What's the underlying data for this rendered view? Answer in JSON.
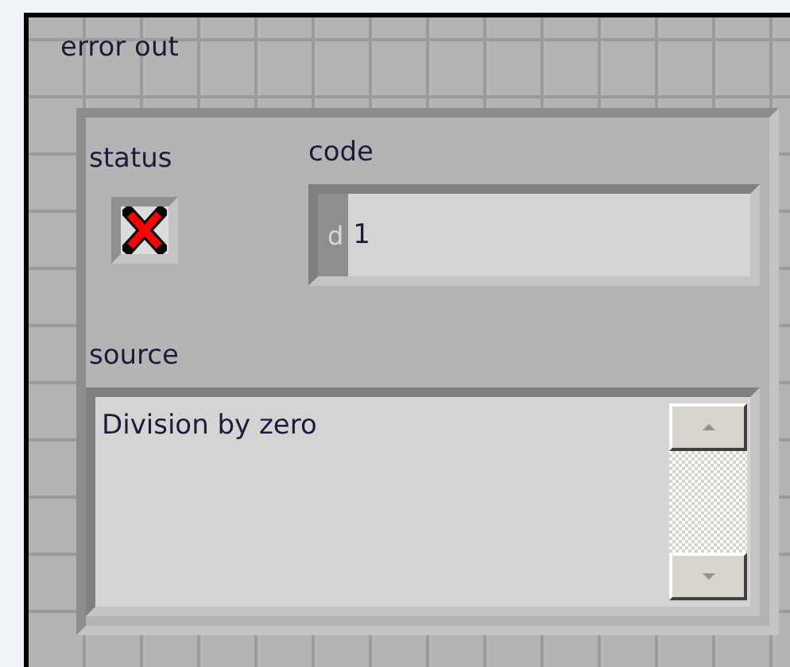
{
  "cluster": {
    "label": "error out",
    "status": {
      "label": "status",
      "error": true
    },
    "code": {
      "label": "code",
      "radix": "d",
      "value": "1"
    },
    "source": {
      "label": "source",
      "value": "Division by zero"
    }
  }
}
